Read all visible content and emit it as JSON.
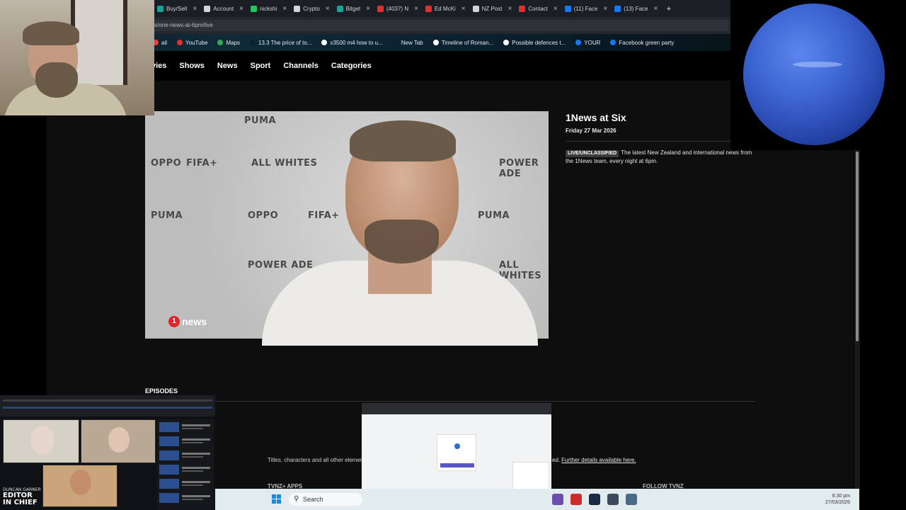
{
  "browser": {
    "tabs": [
      {
        "label": "Buy/Sell",
        "color": "#19a19a"
      },
      {
        "label": "Account",
        "color": "#d0d4dc"
      },
      {
        "label": "nickshi",
        "color": "#23c55e"
      },
      {
        "label": "Crypto",
        "color": "#d0d4dc"
      },
      {
        "label": "Bitget",
        "color": "#19a19a"
      },
      {
        "label": "(4037) N",
        "color": "#e52e2e"
      },
      {
        "label": "Ed McKi",
        "color": "#e52e2e"
      },
      {
        "label": "NZ Post",
        "color": "#d0d4dc"
      },
      {
        "label": "Contact",
        "color": "#e52e2e"
      },
      {
        "label": "(11) Face",
        "color": "#1877f2"
      },
      {
        "label": "(13) Face",
        "color": "#1877f2"
      }
    ],
    "new_tab_glyph": "+",
    "url": "s/one-news-at-6pm/live",
    "bookmarks": [
      {
        "label": "ail",
        "color": "#ea4335"
      },
      {
        "label": "YouTube",
        "color": "#e52e2e"
      },
      {
        "label": "Maps",
        "color": "#34a853"
      },
      {
        "label": "13.3 The price of to...",
        "color": "#0b2230"
      },
      {
        "label": "x3500 m4 how to u...",
        "color": "#ffffff"
      },
      {
        "label": "New Tab",
        "color": "#0b2230"
      },
      {
        "label": "Timeline of Roman...",
        "color": "#ffffff"
      },
      {
        "label": "Possible defences t...",
        "color": "#ffffff"
      },
      {
        "label": "YOUR",
        "color": "#1877f2"
      },
      {
        "label": "Facebook green party",
        "color": "#1877f2"
      }
    ]
  },
  "site_nav": [
    "vies",
    "Shows",
    "News",
    "Sport",
    "Channels",
    "Categories"
  ],
  "video": {
    "sponsors": [
      "PUMA",
      "FIFA+",
      "ALL WHITES",
      "OPPO",
      "POWER ADE"
    ],
    "logo_text": "news",
    "logo_digit": "1"
  },
  "program": {
    "title": "1News at Six",
    "date": "Friday 27 Mar 2026",
    "badge": "LIVE/UNCLASSIFIED",
    "description": "The latest New Zealand and international news from the 1News team, every night at 6pm."
  },
  "episodes_heading": "EPISODES",
  "footer": {
    "text": "Titles, characters and all other elemen",
    "text_end": "ed.",
    "link": "Further details available here.",
    "apps": "TVNZ+ APPS",
    "follow": "FOLLOW TVNZ"
  },
  "overlay_badge": {
    "name_line": "DUNCAN GARNER",
    "line1": "EDITOR",
    "line2": "IN CHIEF"
  },
  "taskbar": {
    "search_placeholder": "Search",
    "time": "6:30 pm",
    "date": "27/03/2026"
  }
}
